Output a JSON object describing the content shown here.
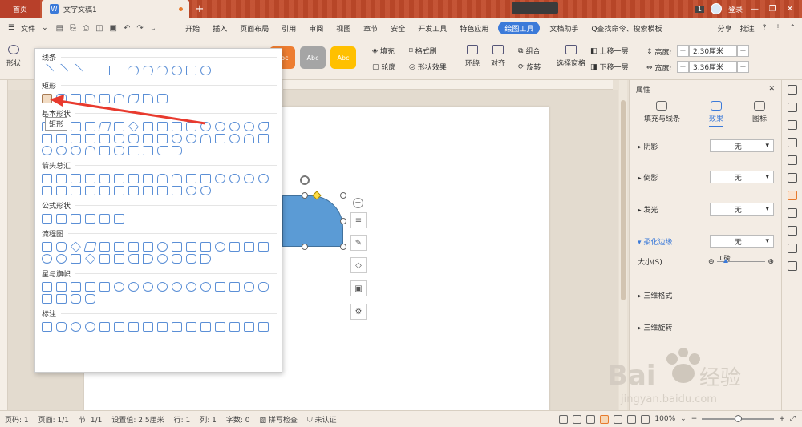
{
  "tabs": {
    "home": "首页",
    "document": "文字文稿1",
    "add": "+"
  },
  "titlebar": {
    "badge": "1",
    "user": "登录",
    "minimize": "—",
    "restore": "❐",
    "close": "✕"
  },
  "menu": {
    "file": "文件",
    "items": [
      "开始",
      "插入",
      "页面布局",
      "引用",
      "审阅",
      "视图",
      "章节",
      "安全",
      "开发工具",
      "特色应用"
    ],
    "active": "绘图工具",
    "after": [
      "文档助手"
    ],
    "search": "Q查找命令、搜索模板",
    "share": "分享",
    "comment": "批注",
    "help": "?"
  },
  "ribbon": {
    "shape": "形状",
    "style_boxes": [
      {
        "label": "Abc",
        "color": "#ed7d31"
      },
      {
        "label": "Abc",
        "color": "#a5a5a5"
      },
      {
        "label": "Abc",
        "color": "#ffc000"
      }
    ],
    "fill": "填充",
    "format_painter": "格式刷",
    "outline": "轮廓",
    "shape_effect": "形状效果",
    "wrap": "环绕",
    "align": "对齐",
    "group": "组合",
    "rotate": "旋转",
    "selection_pane": "选择窗格",
    "bring_forward": "上移一层",
    "send_backward": "下移一层",
    "height_label": "高度:",
    "height_value": "2.30厘米",
    "width_label": "宽度:",
    "width_value": "3.36厘米"
  },
  "shape_panel": {
    "sections": [
      {
        "title": "线条",
        "count": 12
      },
      {
        "title": "矩形",
        "count": 9
      },
      {
        "title": "基本形状",
        "count": 42
      },
      {
        "title": "箭头总汇",
        "count": 28
      },
      {
        "title": "公式形状",
        "count": 6
      },
      {
        "title": "流程图",
        "count": 28
      },
      {
        "title": "星与旗帜",
        "count": 20
      },
      {
        "title": "标注",
        "count": 16
      }
    ],
    "tooltip": "矩形"
  },
  "properties": {
    "title": "属性",
    "tabs": [
      "填充与线条",
      "效果",
      "图标"
    ],
    "active_tab": "效果",
    "rows": [
      {
        "label": "阴影",
        "value": "无"
      },
      {
        "label": "倒影",
        "value": "无"
      },
      {
        "label": "发光",
        "value": "无"
      },
      {
        "label": "柔化边缘",
        "value": "无"
      }
    ],
    "size_label": "大小(S)",
    "size_value": "0磅",
    "three_d_format": "三维格式",
    "three_d_rotate": "三维旋转"
  },
  "status": {
    "page_num": "页码: 1",
    "pages": "页面: 1/1",
    "section": "节: 1/1",
    "setting": "设置值: 2.5厘米",
    "row": "行: 1",
    "col": "列: 1",
    "words": "字数: 0",
    "spellcheck": "拼写检查",
    "auth": "未认证",
    "zoom": "100%",
    "zoom_level": 0.5
  },
  "watermark": {
    "brand": "Bai",
    "brand2": "经验",
    "url": "jingyan.baidu.com"
  }
}
